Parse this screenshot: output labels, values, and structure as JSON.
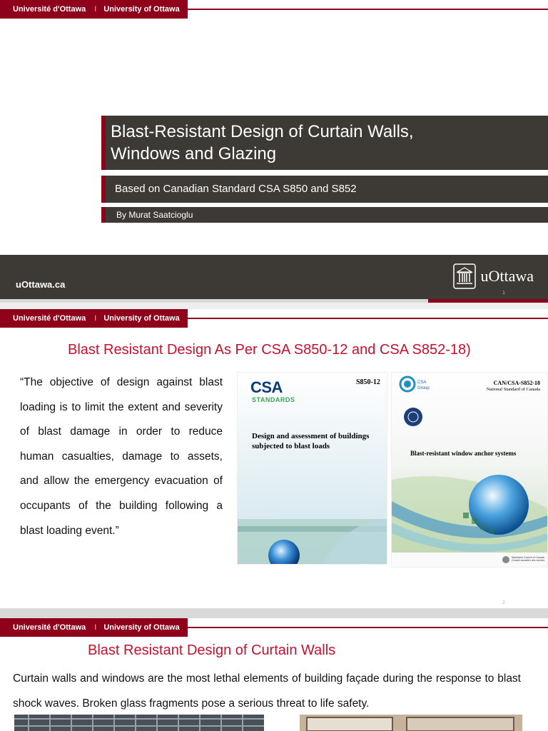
{
  "header": {
    "uni_fr": "Université d'Ottawa",
    "separator": "I",
    "uni_en": "University of Ottawa"
  },
  "slide1": {
    "title_line1": "Blast-Resistant Design of Curtain Walls,",
    "title_line2": "Windows and Glazing",
    "subtitle": "Based on Canadian Standard CSA S850 and S852",
    "author": "By Murat Saatcioglu",
    "footer_url": "uOttawa.ca",
    "footer_logo": "uOttawa",
    "page_number": "1"
  },
  "slide2": {
    "title": "Blast Resistant Design As Per CSA S850-12 and CSA S852-18)",
    "quote": "“The objective of design against blast loading is to limit the extent and severity of blast damage in order to reduce human casualties, damage to assets, and allow the emergency evacuation of occupants of the building following a blast loading event.”",
    "cover1": {
      "brand": "CSA",
      "brand_sub": "STANDARDS",
      "code": "S850-12",
      "title_line1": "Design and assessment of buildings",
      "title_line2": "subjected to blast loads"
    },
    "cover2": {
      "group": "CSA Group",
      "code": "CAN/CSA-S852-18",
      "standard": "National Standard of Canada",
      "title": "Blast-resistant window anchor systems",
      "council_line1": "Standards Council of Canada",
      "council_line2": "Conseil canadien des normes"
    },
    "page_number": "2"
  },
  "slide3": {
    "title": "Blast Resistant Design of Curtain Walls",
    "body": "Curtain walls and windows are the most lethal elements of building façade during the response to blast shock waves. Broken glass fragments pose a serious threat to life safety."
  },
  "colors": {
    "brand_red": "#8f001a",
    "title_red": "#c8102e",
    "dark_gray": "#3d3935"
  }
}
